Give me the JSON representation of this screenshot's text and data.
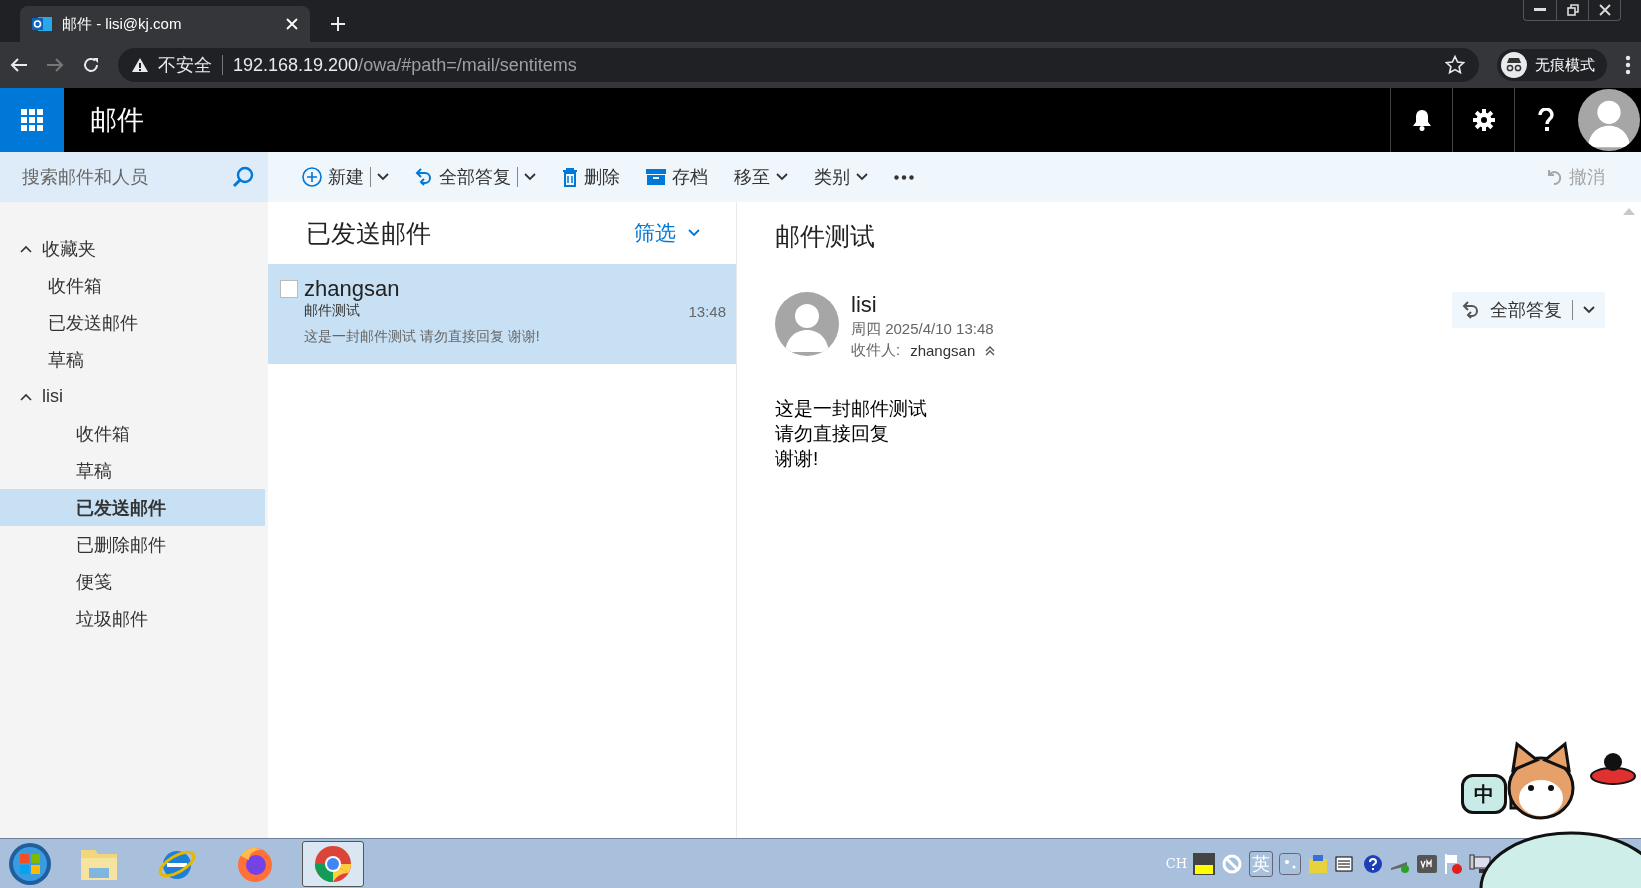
{
  "browser": {
    "tab_title": "邮件 - lisi@kj.com",
    "security": "不安全",
    "host": "192.168.19.200",
    "path": "/owa/#path=/mail/sentitems",
    "profile": "无痕模式"
  },
  "app": {
    "title": "邮件"
  },
  "search": {
    "placeholder": "搜索邮件和人员"
  },
  "toolbar": [
    {
      "kind": "split",
      "label": "新建"
    },
    {
      "kind": "split",
      "label": "全部答复"
    },
    {
      "kind": "plain",
      "label": "删除"
    },
    {
      "kind": "plain",
      "label": "存档"
    },
    {
      "kind": "dropdown",
      "label": "移至"
    },
    {
      "kind": "dropdown",
      "label": "类别"
    },
    {
      "kind": "more"
    }
  ],
  "undo": {
    "label": "撤消",
    "disabled": true
  },
  "folders": [
    {
      "label": "收藏夹",
      "expanded": true,
      "selected": false,
      "children": [
        {
          "label": "收件箱",
          "selected": false
        },
        {
          "label": "已发送邮件",
          "selected": false
        },
        {
          "label": "草稿",
          "selected": false
        }
      ]
    },
    {
      "label": "lisi",
      "expanded": true,
      "selected": false,
      "children": [
        {
          "label": "收件箱",
          "selected": false
        },
        {
          "label": "草稿",
          "selected": false
        },
        {
          "label": "已发送邮件",
          "selected": true
        },
        {
          "label": "已删除邮件",
          "selected": false
        },
        {
          "label": "便笺",
          "selected": false
        },
        {
          "label": "垃圾邮件",
          "selected": false
        }
      ]
    }
  ],
  "message_list": {
    "title": "已发送邮件",
    "filter": "筛选",
    "messages": [
      {
        "from": "zhangsan",
        "subject": "邮件测试",
        "preview": "这是一封邮件测试 请勿直接回复 谢谢!",
        "time": "13:48",
        "selected": true,
        "checked": false
      }
    ]
  },
  "reading_pane": {
    "subject": "邮件测试",
    "sender": "lisi",
    "date": "周四 2025/4/10 13:48",
    "to_label": "收件人:",
    "to": "zhangsan",
    "reply_all": "全部答复",
    "body": [
      "这是一封邮件测试",
      "请勿直接回复",
      "谢谢!"
    ]
  },
  "taskbar": {
    "apps": [
      {
        "active": false
      },
      {
        "active": false
      },
      {
        "active": false
      },
      {
        "active": true
      }
    ],
    "language": "CH",
    "ime_mode": "英",
    "mascot_badge": "中"
  }
}
